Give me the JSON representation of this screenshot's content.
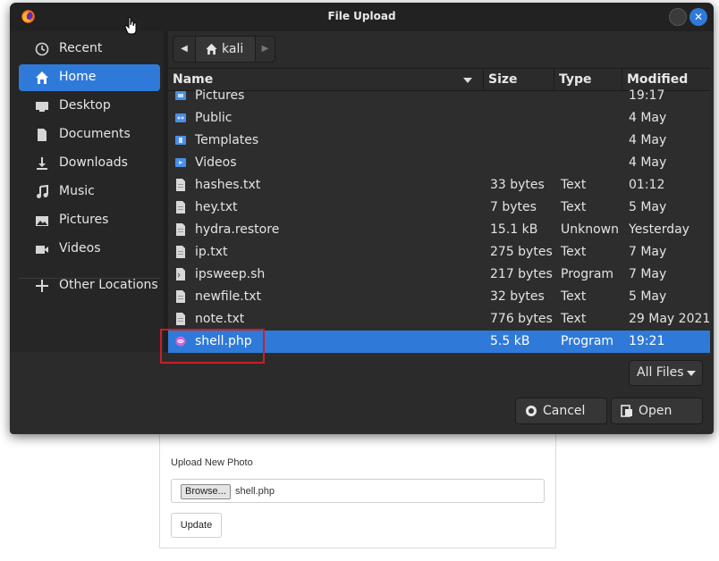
{
  "web": {
    "upload_label": "Upload New Photo",
    "browse_label": "Browse...",
    "chosen_file": "shell.php",
    "update_label": "Update"
  },
  "dialog": {
    "title": "File Upload",
    "sidebar": [
      {
        "label": "Recent",
        "icon": "clock-icon",
        "active": false
      },
      {
        "label": "Home",
        "icon": "home-icon",
        "active": true
      },
      {
        "label": "Desktop",
        "icon": "desktop-icon",
        "active": false
      },
      {
        "label": "Documents",
        "icon": "document-icon",
        "active": false
      },
      {
        "label": "Downloads",
        "icon": "download-icon",
        "active": false
      },
      {
        "label": "Music",
        "icon": "music-icon",
        "active": false
      },
      {
        "label": "Pictures",
        "icon": "picture-icon",
        "active": false
      },
      {
        "label": "Videos",
        "icon": "video-icon",
        "active": false
      },
      {
        "label": "Other Locations",
        "icon": "plus-icon",
        "active": false
      }
    ],
    "path": {
      "current": "kali"
    },
    "columns": {
      "name": "Name",
      "size": "Size",
      "type": "Type",
      "modified": "Modified"
    },
    "files": [
      {
        "name": "Pictures",
        "size": "",
        "type": "",
        "modified": "19:17",
        "kind": "folder-pictures"
      },
      {
        "name": "Public",
        "size": "",
        "type": "",
        "modified": "4 May",
        "kind": "folder-public"
      },
      {
        "name": "Templates",
        "size": "",
        "type": "",
        "modified": "4 May",
        "kind": "folder-templates"
      },
      {
        "name": "Videos",
        "size": "",
        "type": "",
        "modified": "4 May",
        "kind": "folder-videos"
      },
      {
        "name": "hashes.txt",
        "size": "33 bytes",
        "type": "Text",
        "modified": "01:12",
        "kind": "text"
      },
      {
        "name": "hey.txt",
        "size": "7 bytes",
        "type": "Text",
        "modified": "5 May",
        "kind": "text"
      },
      {
        "name": "hydra.restore",
        "size": "15.1 kB",
        "type": "Unknown",
        "modified": "Yesterday",
        "kind": "text"
      },
      {
        "name": "ip.txt",
        "size": "275 bytes",
        "type": "Text",
        "modified": "7 May",
        "kind": "text"
      },
      {
        "name": "ipsweep.sh",
        "size": "217 bytes",
        "type": "Program",
        "modified": "7 May",
        "kind": "script"
      },
      {
        "name": "newfile.txt",
        "size": "32 bytes",
        "type": "Text",
        "modified": "5 May",
        "kind": "text"
      },
      {
        "name": "note.txt",
        "size": "776 bytes",
        "type": "Text",
        "modified": "29 May 2021",
        "kind": "text"
      },
      {
        "name": "shell.php",
        "size": "5.5 kB",
        "type": "Program",
        "modified": "19:21",
        "kind": "php",
        "selected": true
      }
    ],
    "filter_label": "All Files",
    "cancel_label": "Cancel",
    "open_label": "Open"
  },
  "colors": {
    "accent": "#2f7ad8",
    "dialog_bg": "#2b2b2b",
    "sidebar_bg": "#262626",
    "highlight_border": "#c8202a"
  }
}
